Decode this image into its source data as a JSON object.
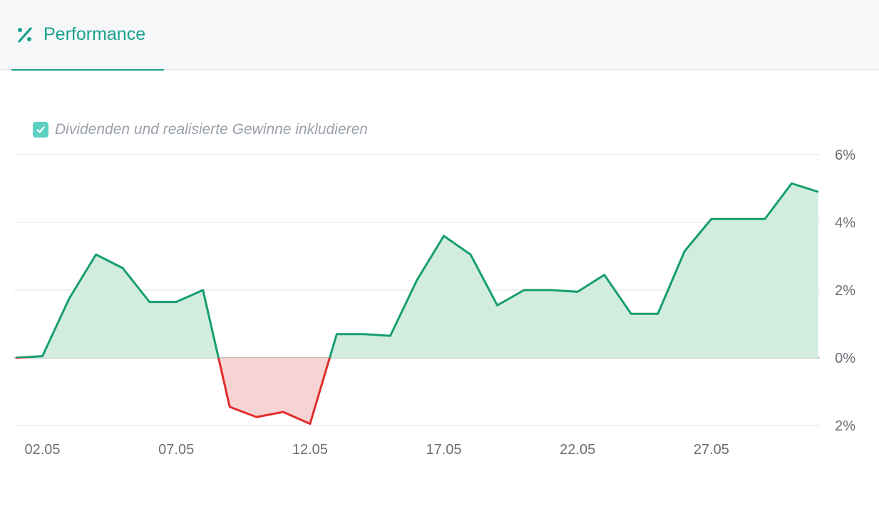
{
  "tab": {
    "icon": "percent-icon",
    "label": "Performance",
    "color": "#1aa18d"
  },
  "checkbox": {
    "checked": true,
    "label": "Dividenden und realisierte Gewinne inkludieren",
    "color": "#5ccfc0"
  },
  "chart_data": {
    "type": "area",
    "x": [
      "01.05",
      "02.05",
      "03.05",
      "04.05",
      "05.05",
      "06.05",
      "07.05",
      "08.05",
      "09.05",
      "10.05",
      "11.05",
      "12.05",
      "13.05",
      "14.05",
      "15.05",
      "16.05",
      "17.05",
      "18.05",
      "19.05",
      "20.05",
      "21.05",
      "22.05",
      "23.05",
      "24.05",
      "25.05",
      "26.05",
      "27.05",
      "28.05",
      "29.05",
      "30.05",
      "31.05"
    ],
    "series": [
      {
        "values": [
          0.0,
          0.05,
          1.75,
          3.05,
          2.65,
          1.65,
          1.65,
          2.0,
          -1.45,
          -1.75,
          -1.6,
          -1.95,
          0.7,
          0.7,
          0.65,
          2.3,
          3.6,
          3.05,
          1.55,
          2.0,
          2.0,
          1.95,
          2.45,
          1.3,
          1.3,
          3.15,
          4.1,
          4.1,
          4.1,
          5.15,
          4.9
        ]
      }
    ],
    "x_tick_labels": [
      "02.05",
      "07.05",
      "12.05",
      "17.05",
      "22.05",
      "27.05"
    ],
    "y_tick_labels": [
      "6%",
      "4%",
      "2%",
      "0%",
      "2%"
    ],
    "ylim": [
      -2,
      6
    ],
    "y_axis_position": "right",
    "grid": true,
    "positive_color": "#169e6c",
    "positive_fill": "#d2ede0",
    "negative_color": "#e02b2b",
    "negative_fill": "#f8d3d4",
    "zero_line_color": "#bdbdbd"
  }
}
